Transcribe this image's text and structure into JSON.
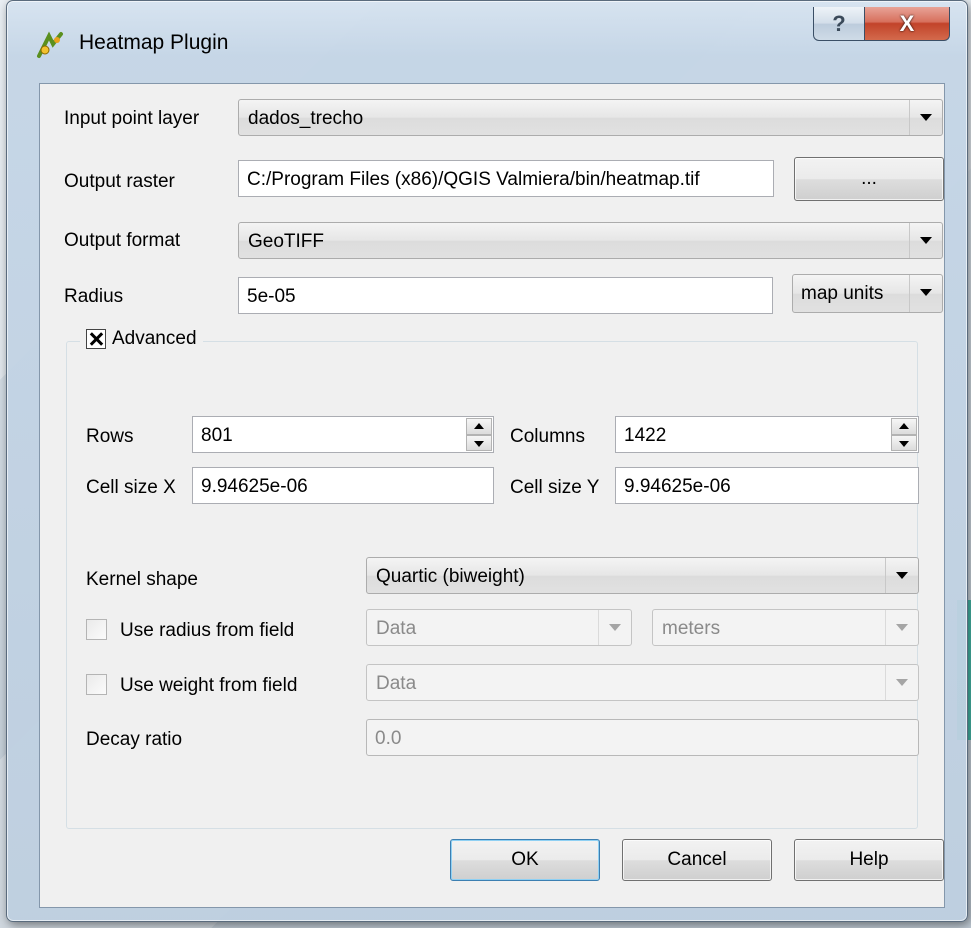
{
  "window": {
    "title": "Heatmap Plugin",
    "help_glyph": "?",
    "close_glyph": "X"
  },
  "form": {
    "input_layer": {
      "label": "Input point layer",
      "value": "dados_trecho"
    },
    "output_raster": {
      "label": "Output raster",
      "value": "C:/Program Files (x86)/QGIS Valmiera/bin/heatmap.tif",
      "browse_label": "..."
    },
    "output_format": {
      "label": "Output format",
      "value": "GeoTIFF"
    },
    "radius": {
      "label": "Radius",
      "value": "5e-05",
      "units": "map units"
    }
  },
  "advanced": {
    "title": "Advanced",
    "checked": true,
    "rows": {
      "label": "Rows",
      "value": "801"
    },
    "columns": {
      "label": "Columns",
      "value": "1422"
    },
    "cell_size_x": {
      "label": "Cell size X",
      "value": "9.94625e-06"
    },
    "cell_size_y": {
      "label": "Cell size Y",
      "value": "9.94625e-06"
    },
    "kernel_shape": {
      "label": "Kernel shape",
      "value": "Quartic (biweight)"
    },
    "radius_field": {
      "label": "Use radius from field",
      "checked": false,
      "field": "Data",
      "units": "meters"
    },
    "weight_field": {
      "label": "Use weight from field",
      "checked": false,
      "field": "Data"
    },
    "decay_ratio": {
      "label": "Decay ratio",
      "value": "0.0"
    }
  },
  "buttons": {
    "ok": "OK",
    "cancel": "Cancel",
    "help": "Help"
  },
  "colors": {
    "close_button": "#c2432a",
    "dialog_bg": "#f0f0f0",
    "default_button_border": "#3c7fb1"
  }
}
